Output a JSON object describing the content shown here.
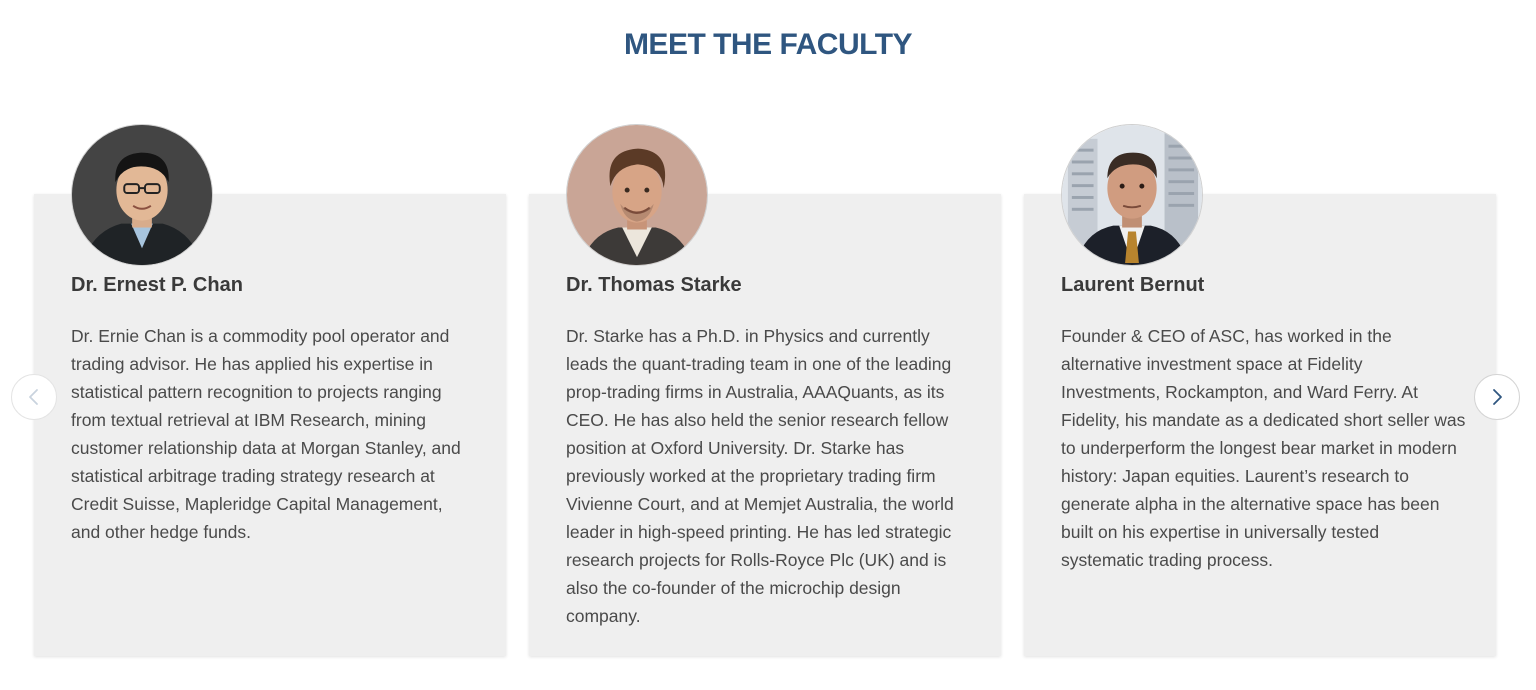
{
  "section": {
    "title": "MEET THE FACULTY"
  },
  "colors": {
    "heading": "#2f5680",
    "card_background": "#efefef",
    "nav_arrow_active": "#2f5680",
    "nav_arrow_disabled": "#c9d3de"
  },
  "faculty": [
    {
      "name": "Dr. Ernest P. Chan",
      "bio": "Dr. Ernie Chan is a commodity pool operator and trading advisor. He has applied his expertise in statistical pattern recognition to projects ranging from textual retrieval at IBM Research, mining customer relationship data at Morgan Stanley, and statistical arbitrage trading strategy research at Credit Suisse, Mapleridge Capital Management, and other hedge funds.",
      "photo_icon": "portrait-photo"
    },
    {
      "name": "Dr. Thomas Starke",
      "bio": "Dr. Starke has a Ph.D. in Physics and currently leads the quant-trading team in one of the leading prop-trading firms in Australia, AAAQuants, as its CEO. He has also held the senior research fellow position at Oxford University. Dr. Starke has previously worked at the proprietary trading firm Vivienne Court, and at Memjet Australia, the world leader in high-speed printing. He has led strategic research projects for Rolls-Royce Plc (UK) and is also the co-founder of the microchip design company.",
      "photo_icon": "portrait-photo"
    },
    {
      "name": "Laurent Bernut",
      "bio": "Founder & CEO of ASC, has worked in the alternative investment space at Fidelity Investments, Rockampton, and Ward Ferry. At Fidelity, his mandate as a dedicated short seller was to underperform the longest bear market in modern history: Japan equities. Laurent’s research to generate alpha in the alternative space has been built on his expertise in universally tested systematic trading process.",
      "photo_icon": "portrait-photo"
    }
  ],
  "carousel": {
    "prev_icon": "chevron-left-icon",
    "next_icon": "chevron-right-icon"
  }
}
